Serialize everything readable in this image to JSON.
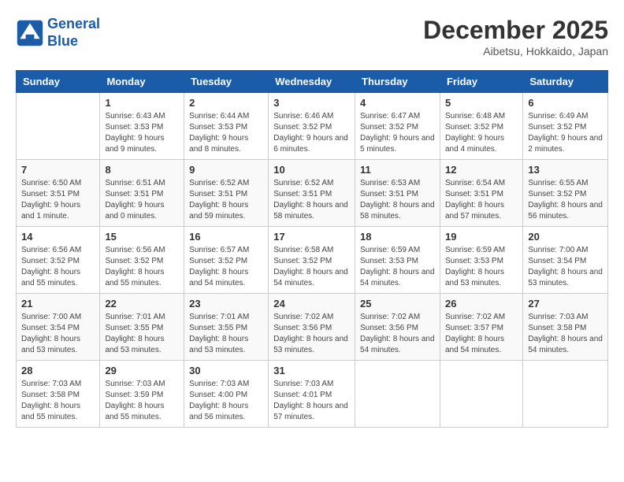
{
  "logo": {
    "line1": "General",
    "line2": "Blue"
  },
  "title": "December 2025",
  "subtitle": "Aibetsu, Hokkaido, Japan",
  "weekdays": [
    "Sunday",
    "Monday",
    "Tuesday",
    "Wednesday",
    "Thursday",
    "Friday",
    "Saturday"
  ],
  "weeks": [
    [
      {
        "num": "",
        "sunrise": "",
        "sunset": "",
        "daylight": ""
      },
      {
        "num": "1",
        "sunrise": "Sunrise: 6:43 AM",
        "sunset": "Sunset: 3:53 PM",
        "daylight": "Daylight: 9 hours and 9 minutes."
      },
      {
        "num": "2",
        "sunrise": "Sunrise: 6:44 AM",
        "sunset": "Sunset: 3:53 PM",
        "daylight": "Daylight: 9 hours and 8 minutes."
      },
      {
        "num": "3",
        "sunrise": "Sunrise: 6:46 AM",
        "sunset": "Sunset: 3:52 PM",
        "daylight": "Daylight: 9 hours and 6 minutes."
      },
      {
        "num": "4",
        "sunrise": "Sunrise: 6:47 AM",
        "sunset": "Sunset: 3:52 PM",
        "daylight": "Daylight: 9 hours and 5 minutes."
      },
      {
        "num": "5",
        "sunrise": "Sunrise: 6:48 AM",
        "sunset": "Sunset: 3:52 PM",
        "daylight": "Daylight: 9 hours and 4 minutes."
      },
      {
        "num": "6",
        "sunrise": "Sunrise: 6:49 AM",
        "sunset": "Sunset: 3:52 PM",
        "daylight": "Daylight: 9 hours and 2 minutes."
      }
    ],
    [
      {
        "num": "7",
        "sunrise": "Sunrise: 6:50 AM",
        "sunset": "Sunset: 3:51 PM",
        "daylight": "Daylight: 9 hours and 1 minute."
      },
      {
        "num": "8",
        "sunrise": "Sunrise: 6:51 AM",
        "sunset": "Sunset: 3:51 PM",
        "daylight": "Daylight: 9 hours and 0 minutes."
      },
      {
        "num": "9",
        "sunrise": "Sunrise: 6:52 AM",
        "sunset": "Sunset: 3:51 PM",
        "daylight": "Daylight: 8 hours and 59 minutes."
      },
      {
        "num": "10",
        "sunrise": "Sunrise: 6:52 AM",
        "sunset": "Sunset: 3:51 PM",
        "daylight": "Daylight: 8 hours and 58 minutes."
      },
      {
        "num": "11",
        "sunrise": "Sunrise: 6:53 AM",
        "sunset": "Sunset: 3:51 PM",
        "daylight": "Daylight: 8 hours and 58 minutes."
      },
      {
        "num": "12",
        "sunrise": "Sunrise: 6:54 AM",
        "sunset": "Sunset: 3:51 PM",
        "daylight": "Daylight: 8 hours and 57 minutes."
      },
      {
        "num": "13",
        "sunrise": "Sunrise: 6:55 AM",
        "sunset": "Sunset: 3:52 PM",
        "daylight": "Daylight: 8 hours and 56 minutes."
      }
    ],
    [
      {
        "num": "14",
        "sunrise": "Sunrise: 6:56 AM",
        "sunset": "Sunset: 3:52 PM",
        "daylight": "Daylight: 8 hours and 55 minutes."
      },
      {
        "num": "15",
        "sunrise": "Sunrise: 6:56 AM",
        "sunset": "Sunset: 3:52 PM",
        "daylight": "Daylight: 8 hours and 55 minutes."
      },
      {
        "num": "16",
        "sunrise": "Sunrise: 6:57 AM",
        "sunset": "Sunset: 3:52 PM",
        "daylight": "Daylight: 8 hours and 54 minutes."
      },
      {
        "num": "17",
        "sunrise": "Sunrise: 6:58 AM",
        "sunset": "Sunset: 3:52 PM",
        "daylight": "Daylight: 8 hours and 54 minutes."
      },
      {
        "num": "18",
        "sunrise": "Sunrise: 6:59 AM",
        "sunset": "Sunset: 3:53 PM",
        "daylight": "Daylight: 8 hours and 54 minutes."
      },
      {
        "num": "19",
        "sunrise": "Sunrise: 6:59 AM",
        "sunset": "Sunset: 3:53 PM",
        "daylight": "Daylight: 8 hours and 53 minutes."
      },
      {
        "num": "20",
        "sunrise": "Sunrise: 7:00 AM",
        "sunset": "Sunset: 3:54 PM",
        "daylight": "Daylight: 8 hours and 53 minutes."
      }
    ],
    [
      {
        "num": "21",
        "sunrise": "Sunrise: 7:00 AM",
        "sunset": "Sunset: 3:54 PM",
        "daylight": "Daylight: 8 hours and 53 minutes."
      },
      {
        "num": "22",
        "sunrise": "Sunrise: 7:01 AM",
        "sunset": "Sunset: 3:55 PM",
        "daylight": "Daylight: 8 hours and 53 minutes."
      },
      {
        "num": "23",
        "sunrise": "Sunrise: 7:01 AM",
        "sunset": "Sunset: 3:55 PM",
        "daylight": "Daylight: 8 hours and 53 minutes."
      },
      {
        "num": "24",
        "sunrise": "Sunrise: 7:02 AM",
        "sunset": "Sunset: 3:56 PM",
        "daylight": "Daylight: 8 hours and 53 minutes."
      },
      {
        "num": "25",
        "sunrise": "Sunrise: 7:02 AM",
        "sunset": "Sunset: 3:56 PM",
        "daylight": "Daylight: 8 hours and 54 minutes."
      },
      {
        "num": "26",
        "sunrise": "Sunrise: 7:02 AM",
        "sunset": "Sunset: 3:57 PM",
        "daylight": "Daylight: 8 hours and 54 minutes."
      },
      {
        "num": "27",
        "sunrise": "Sunrise: 7:03 AM",
        "sunset": "Sunset: 3:58 PM",
        "daylight": "Daylight: 8 hours and 54 minutes."
      }
    ],
    [
      {
        "num": "28",
        "sunrise": "Sunrise: 7:03 AM",
        "sunset": "Sunset: 3:58 PM",
        "daylight": "Daylight: 8 hours and 55 minutes."
      },
      {
        "num": "29",
        "sunrise": "Sunrise: 7:03 AM",
        "sunset": "Sunset: 3:59 PM",
        "daylight": "Daylight: 8 hours and 55 minutes."
      },
      {
        "num": "30",
        "sunrise": "Sunrise: 7:03 AM",
        "sunset": "Sunset: 4:00 PM",
        "daylight": "Daylight: 8 hours and 56 minutes."
      },
      {
        "num": "31",
        "sunrise": "Sunrise: 7:03 AM",
        "sunset": "Sunset: 4:01 PM",
        "daylight": "Daylight: 8 hours and 57 minutes."
      },
      {
        "num": "",
        "sunrise": "",
        "sunset": "",
        "daylight": ""
      },
      {
        "num": "",
        "sunrise": "",
        "sunset": "",
        "daylight": ""
      },
      {
        "num": "",
        "sunrise": "",
        "sunset": "",
        "daylight": ""
      }
    ]
  ]
}
